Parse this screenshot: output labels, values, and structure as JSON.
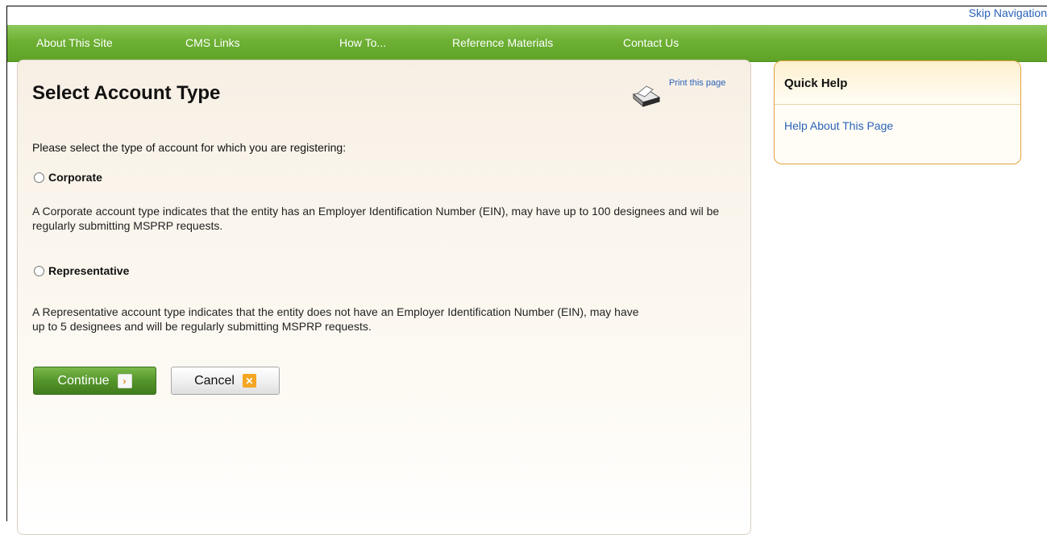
{
  "skip_navigation": "Skip Navigation",
  "nav": {
    "items": [
      {
        "label": "About This Site"
      },
      {
        "label": "CMS Links"
      },
      {
        "label": "How To..."
      },
      {
        "label": "Reference Materials"
      },
      {
        "label": "Contact Us"
      }
    ]
  },
  "main": {
    "title": "Select Account Type",
    "print_label": "Print this page",
    "intro": "Please select the type of account for which you are registering:",
    "options": [
      {
        "label": "Corporate",
        "description": "A Corporate account type indicates that the entity has an Employer Identification Number (EIN), may have up to 100 designees and wil be regularly submitting MSPRP requests."
      },
      {
        "label": "Representative",
        "description": "A Representative account type indicates that the entity does not have an Employer Identification Number (EIN), may have up to 5 designees and will be regularly submitting MSPRP requests."
      }
    ],
    "continue_label": "Continue",
    "cancel_label": "Cancel"
  },
  "quick_help": {
    "title": "Quick Help",
    "link": "Help About This Page"
  },
  "colors": {
    "nav_green": "#6db033",
    "link_blue": "#2a62b8",
    "help_border": "#e1a33b",
    "cancel_icon": "#f4a623"
  },
  "icons": [
    "printer-icon",
    "arrow-right-icon",
    "close-icon"
  ]
}
